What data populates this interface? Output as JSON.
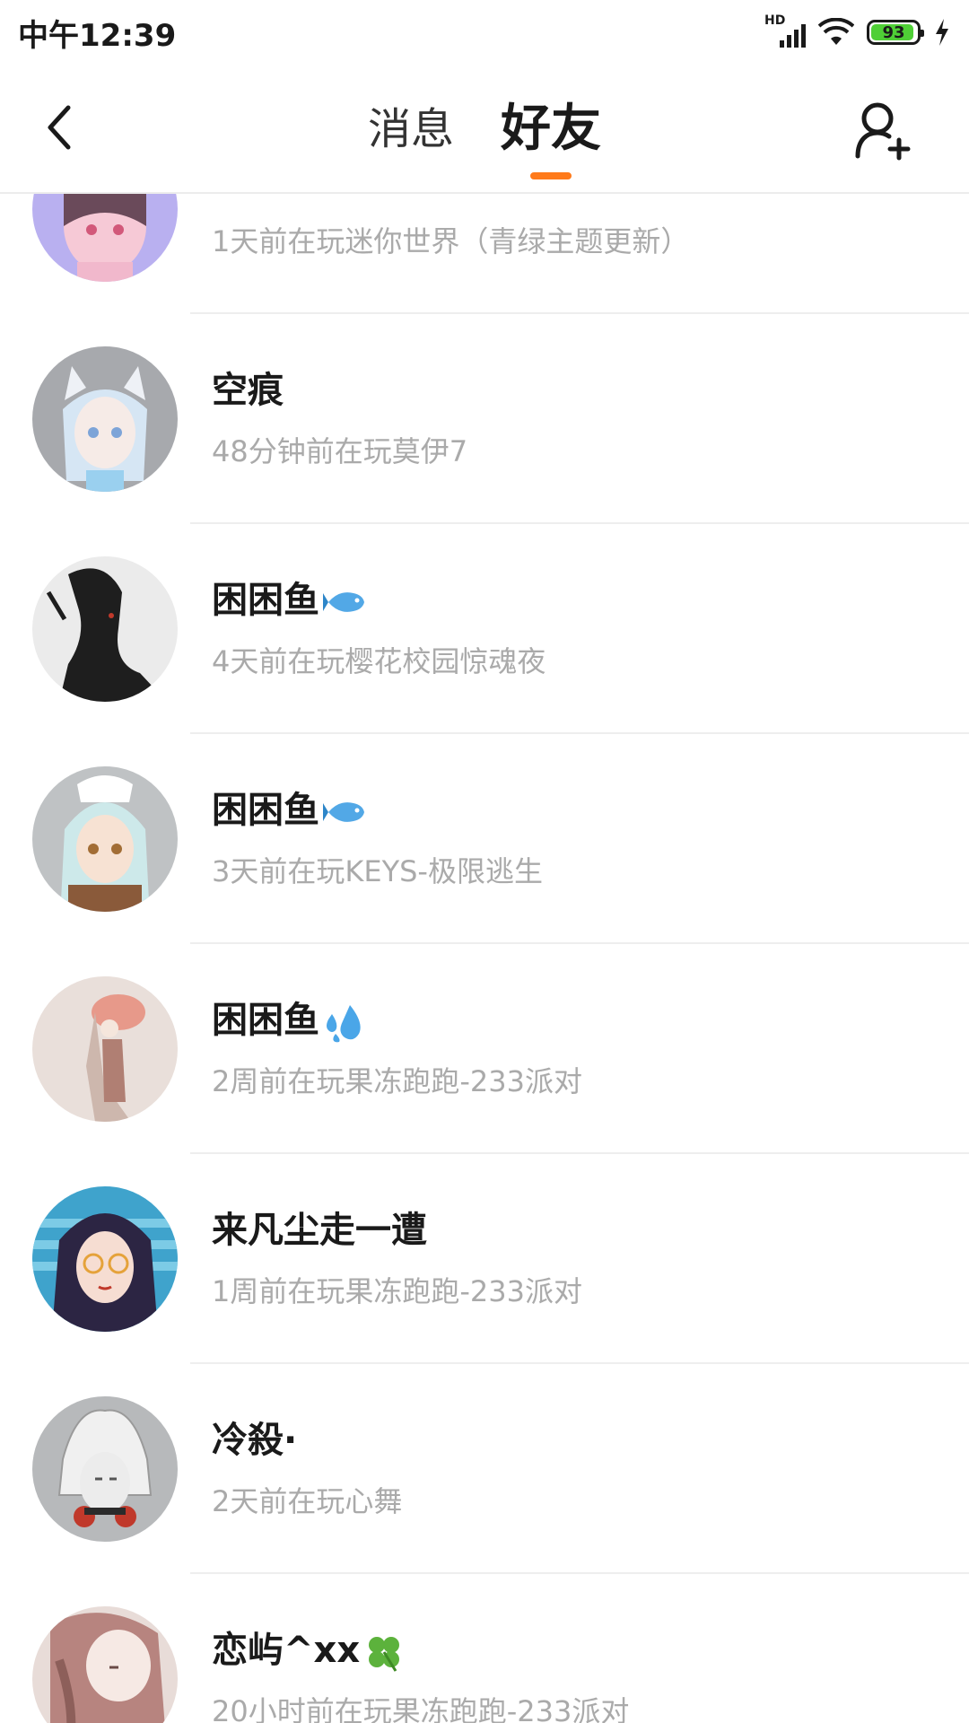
{
  "status_bar": {
    "time": "中午12:39",
    "network_label": "HD",
    "battery_level": "93",
    "battery_fraction": 0.93,
    "icons": [
      "signal-icon",
      "wifi-icon",
      "battery-icon",
      "charging-icon"
    ]
  },
  "nav": {
    "back_icon": "chevron-left-icon",
    "tabs": [
      {
        "label": "消息",
        "active": false
      },
      {
        "label": "好友",
        "active": true
      }
    ],
    "add_friend_icon": "add-user-icon",
    "accent_color": "#ff7a1a"
  },
  "friends": [
    {
      "name": "",
      "status": "1天前在玩迷你世界（青绿主题更新）",
      "emoji": ""
    },
    {
      "name": "空痕",
      "status": "48分钟前在玩莫伊7",
      "emoji": ""
    },
    {
      "name": "困困鱼",
      "status": "4天前在玩樱花校园惊魂夜",
      "emoji": "fish-icon"
    },
    {
      "name": "困困鱼",
      "status": "3天前在玩KEYS-极限逃生",
      "emoji": "fish-icon"
    },
    {
      "name": "困困鱼",
      "status": "2周前在玩果冻跑跑-233派对",
      "emoji": "droplets-icon"
    },
    {
      "name": "来凡尘走一遭",
      "status": "1周前在玩果冻跑跑-233派对",
      "emoji": ""
    },
    {
      "name": "冷殺·",
      "status": "2天前在玩心舞",
      "emoji": ""
    },
    {
      "name": "恋屿^xx",
      "status": "20小时前在玩果冻跑跑-233派对",
      "emoji": "clover-icon"
    }
  ]
}
